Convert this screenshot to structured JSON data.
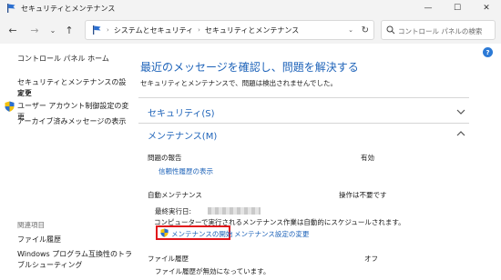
{
  "window": {
    "title": "セキュリティとメンテナンス"
  },
  "controls": {
    "minimize": "—",
    "maximize": "☐",
    "close": "✕"
  },
  "address": {
    "crumbs": [
      "システムとセキュリティ",
      "セキュリティとメンテナンス"
    ],
    "separator": "›",
    "search_placeholder": "コントロール パネルの検索"
  },
  "sidebar": {
    "links": [
      "コントロール パネル ホーム",
      "セキュリティとメンテナンスの設定を",
      "変更",
      "ユーザー アカウント制御設定の変更",
      "アーカイブ済みメッセージの表示"
    ],
    "related_title": "関連項目",
    "related_links": [
      "ファイル履歴",
      "Windows プログラム互換性のトラ",
      "ブルシューティング"
    ]
  },
  "main": {
    "heading": "最近のメッセージを確認し、問題を解決する",
    "subtext": "セキュリティとメンテナンスで、問題は検出されませんでした。",
    "help_glyph": "?",
    "security": {
      "title": "セキュリティ(S)"
    },
    "maintenance": {
      "title": "メンテナンス(M)",
      "problem_reports": {
        "label": "問題の報告",
        "status": "有効",
        "link": "信頼性履歴の表示"
      },
      "auto": {
        "label": "自動メンテナンス",
        "status": "操作は不要です",
        "last_run_label": "最終実行日:",
        "description": "コンピューターで実行されるメンテナンス作業は自動的にスケジュールされます。",
        "start_link": "メンテナンスの開始",
        "settings_link": "メンテナンス設定の変更"
      },
      "file_history": {
        "label": "ファイル履歴",
        "status": "オフ",
        "description": "ファイル履歴が無効になっています。"
      }
    }
  },
  "colors": {
    "accent": "#1e63b9",
    "highlight": "#e1141b",
    "shield_blue": "#2b6fd1",
    "shield_yellow": "#f4c20d"
  }
}
